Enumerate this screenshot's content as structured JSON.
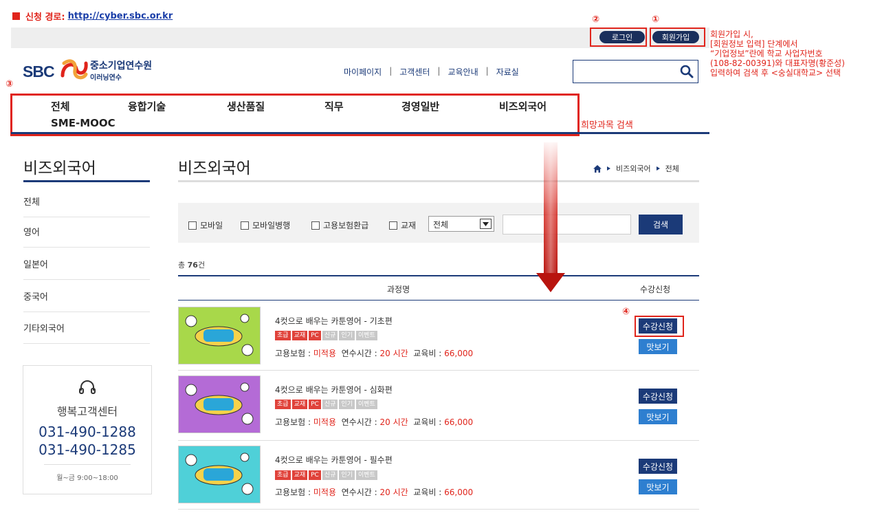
{
  "instruction": {
    "label": "신청 경로:",
    "url": "http://cyber.sbc.or.kr",
    "step_login": "②",
    "step_join": "①",
    "step_nav": "③",
    "step_apply": "④",
    "note_lines": [
      "회원가입 시,",
      "[회원정보 입력] 단계에서",
      "“기업정보”란에 학교 사업자번호",
      "(108-82-00391)와 대표자명(황준성)",
      "입력하여 검색 후 <숭실대학교> 선택"
    ],
    "hope_search": "희망과목 검색"
  },
  "header": {
    "login": "로그인",
    "join": "회원가입",
    "logo_brand": "SBC",
    "logo_title": "중소기업연수원",
    "logo_sub": "이러닝연수",
    "util_links": [
      "마이페이지",
      "고객센터",
      "교육안내",
      "자료실"
    ]
  },
  "nav": [
    "전체",
    "융합기술",
    "생산품질",
    "직무",
    "경영일반",
    "비즈외국어",
    "SME-MOOC"
  ],
  "sidebar": {
    "title": "비즈외국어",
    "items": [
      "전체",
      "영어",
      "일본어",
      "중국어",
      "기타외국어"
    ],
    "cs_title": "행복고객센터",
    "cs_phone1": "031-490-1288",
    "cs_phone2": "031-490-1285",
    "cs_hours": "월~금 9:00~18:00"
  },
  "main": {
    "title": "비즈외국어",
    "breadcrumb": [
      "비즈외국어",
      "전체"
    ],
    "filters": [
      "모바일",
      "모바일병행",
      "고용보험환급",
      "교재"
    ],
    "select_value": "전체",
    "search_button": "검색",
    "total_prefix": "총",
    "total_count": "76",
    "total_suffix": "건",
    "col_course": "과정명",
    "col_apply": "수강신청"
  },
  "courses": [
    {
      "title": "4컷으로 배우는 카툰영어 - 기초편",
      "tags": [
        "초급",
        "교재",
        "PC",
        "신규",
        "인기",
        "이벤트"
      ],
      "insurance_label": "고용보험 :",
      "insurance": "미적용",
      "hours_label": "연수시간 :",
      "hours": "20 시간",
      "fee_label": "교육비 :",
      "fee": "66,000",
      "apply": "수강신청",
      "preview": "맛보기",
      "thumb_color": "#a8d84a"
    },
    {
      "title": "4컷으로 배우는 카툰영어 - 심화편",
      "tags": [
        "초급",
        "교재",
        "PC",
        "신규",
        "인기",
        "이벤트"
      ],
      "insurance_label": "고용보험 :",
      "insurance": "미적용",
      "hours_label": "연수시간 :",
      "hours": "20 시간",
      "fee_label": "교육비 :",
      "fee": "66,000",
      "apply": "수강신청",
      "preview": "맛보기",
      "thumb_color": "#b46bd6"
    },
    {
      "title": "4컷으로 배우는 카툰영어 - 필수편",
      "tags": [
        "초급",
        "교재",
        "PC",
        "신규",
        "인기",
        "이벤트"
      ],
      "insurance_label": "고용보험 :",
      "insurance": "미적용",
      "hours_label": "연수시간 :",
      "hours": "20 시간",
      "fee_label": "교육비 :",
      "fee": "66,000",
      "apply": "수강신청",
      "preview": "맛보기",
      "thumb_color": "#4fd0d8"
    }
  ]
}
